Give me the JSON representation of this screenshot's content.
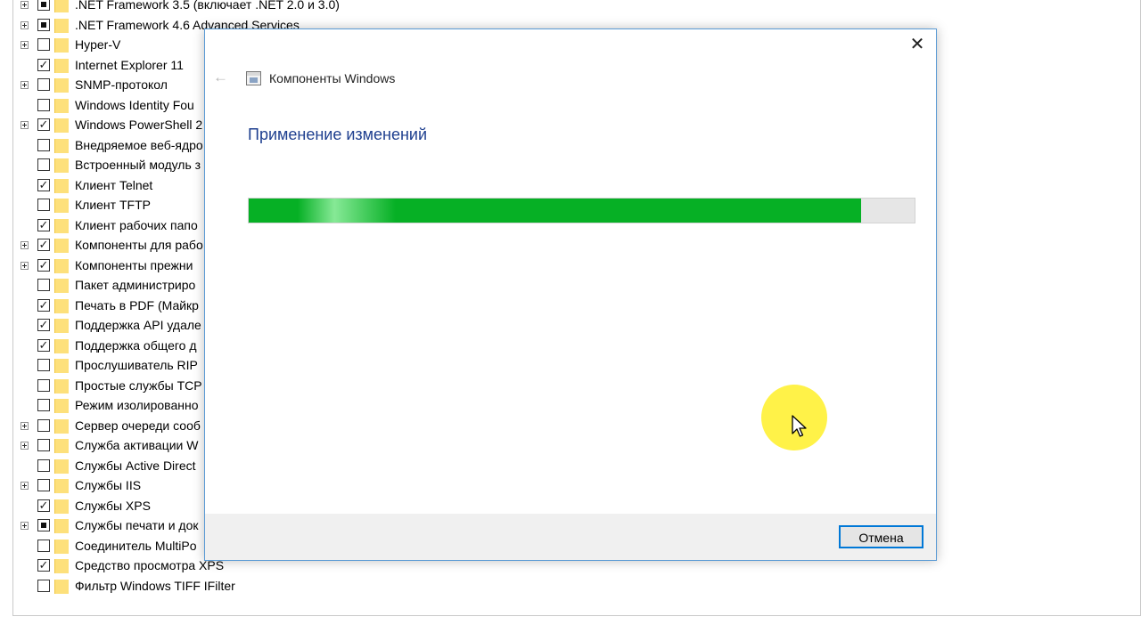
{
  "features": [
    {
      "label": ".NET Framework 3.5 (включает .NET 2.0 и 3.0)",
      "state": "partial",
      "expandable": true
    },
    {
      "label": ".NET Framework 4.6 Advanced Services",
      "state": "partial",
      "expandable": true
    },
    {
      "label": "Hyper-V",
      "state": "unchecked",
      "expandable": true
    },
    {
      "label": "Internet Explorer 11",
      "state": "checked",
      "expandable": false
    },
    {
      "label": "SNMP-протокол",
      "state": "unchecked",
      "expandable": true
    },
    {
      "label": "Windows Identity Fou",
      "state": "unchecked",
      "expandable": false
    },
    {
      "label": "Windows PowerShell 2",
      "state": "checked",
      "expandable": true
    },
    {
      "label": "Внедряемое веб-ядро",
      "state": "unchecked",
      "expandable": false
    },
    {
      "label": "Встроенный модуль з",
      "state": "unchecked",
      "expandable": false
    },
    {
      "label": "Клиент Telnet",
      "state": "checked",
      "expandable": false
    },
    {
      "label": "Клиент TFTP",
      "state": "unchecked",
      "expandable": false
    },
    {
      "label": "Клиент рабочих папо",
      "state": "checked",
      "expandable": false
    },
    {
      "label": "Компоненты для рабо",
      "state": "checked",
      "expandable": true
    },
    {
      "label": "Компоненты прежни",
      "state": "checked",
      "expandable": true
    },
    {
      "label": "Пакет администриро",
      "state": "unchecked",
      "expandable": false
    },
    {
      "label": "Печать в PDF (Майкр",
      "state": "checked",
      "expandable": false
    },
    {
      "label": "Поддержка API удале",
      "state": "checked",
      "expandable": false
    },
    {
      "label": "Поддержка общего д",
      "state": "checked",
      "expandable": false
    },
    {
      "label": "Прослушиватель RIP",
      "state": "unchecked",
      "expandable": false
    },
    {
      "label": "Простые службы TCP",
      "state": "unchecked",
      "expandable": false
    },
    {
      "label": "Режим изолированно",
      "state": "unchecked",
      "expandable": false
    },
    {
      "label": "Сервер очереди сооб",
      "state": "unchecked",
      "expandable": true
    },
    {
      "label": "Служба активации W",
      "state": "unchecked",
      "expandable": true
    },
    {
      "label": "Службы Active Direct",
      "state": "unchecked",
      "expandable": false
    },
    {
      "label": "Службы IIS",
      "state": "unchecked",
      "expandable": true
    },
    {
      "label": "Службы XPS",
      "state": "checked",
      "expandable": false
    },
    {
      "label": "Службы печати и док",
      "state": "partial",
      "expandable": true
    },
    {
      "label": "Соединитель MultiPo",
      "state": "unchecked",
      "expandable": false
    },
    {
      "label": "Средство просмотра XPS",
      "state": "checked",
      "expandable": false
    },
    {
      "label": "Фильтр Windows TIFF IFilter",
      "state": "unchecked",
      "expandable": false
    }
  ],
  "dialog": {
    "title": "Компоненты Windows",
    "heading": "Применение изменений",
    "progress_percent": 92,
    "cancel_label": "Отмена",
    "close_symbol": "✕",
    "back_symbol": "←"
  },
  "icons": {
    "checkmark": "✓",
    "folder": "folder-icon",
    "app": "windows-features-icon",
    "cursor": "mouse-cursor-icon"
  },
  "colors": {
    "progress": "#06b025",
    "accent": "#0078d7",
    "heading": "#1e3f8f",
    "cursor_highlight": "#fff028"
  }
}
